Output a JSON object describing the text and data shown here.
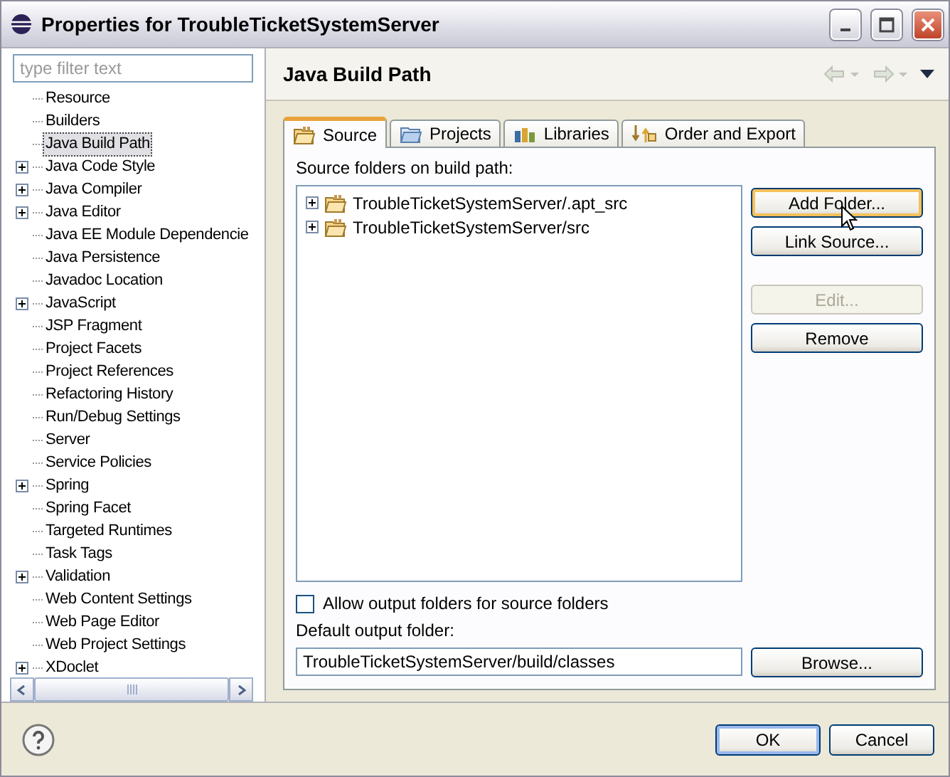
{
  "window": {
    "title": "Properties for TroubleTicketSystemServer"
  },
  "filter": {
    "placeholder": "type filter text"
  },
  "tree": {
    "items": [
      {
        "label": "Resource",
        "expandable": false,
        "selected": false
      },
      {
        "label": "Builders",
        "expandable": false,
        "selected": false
      },
      {
        "label": "Java Build Path",
        "expandable": false,
        "selected": true
      },
      {
        "label": "Java Code Style",
        "expandable": true,
        "selected": false
      },
      {
        "label": "Java Compiler",
        "expandable": true,
        "selected": false
      },
      {
        "label": "Java Editor",
        "expandable": true,
        "selected": false
      },
      {
        "label": "Java EE Module Dependencie",
        "expandable": false,
        "selected": false
      },
      {
        "label": "Java Persistence",
        "expandable": false,
        "selected": false
      },
      {
        "label": "Javadoc Location",
        "expandable": false,
        "selected": false
      },
      {
        "label": "JavaScript",
        "expandable": true,
        "selected": false
      },
      {
        "label": "JSP Fragment",
        "expandable": false,
        "selected": false
      },
      {
        "label": "Project Facets",
        "expandable": false,
        "selected": false
      },
      {
        "label": "Project References",
        "expandable": false,
        "selected": false
      },
      {
        "label": "Refactoring History",
        "expandable": false,
        "selected": false
      },
      {
        "label": "Run/Debug Settings",
        "expandable": false,
        "selected": false
      },
      {
        "label": "Server",
        "expandable": false,
        "selected": false
      },
      {
        "label": "Service Policies",
        "expandable": false,
        "selected": false
      },
      {
        "label": "Spring",
        "expandable": true,
        "selected": false
      },
      {
        "label": "Spring Facet",
        "expandable": false,
        "selected": false
      },
      {
        "label": "Targeted Runtimes",
        "expandable": false,
        "selected": false
      },
      {
        "label": "Task Tags",
        "expandable": false,
        "selected": false
      },
      {
        "label": "Validation",
        "expandable": true,
        "selected": false
      },
      {
        "label": "Web Content Settings",
        "expandable": false,
        "selected": false
      },
      {
        "label": "Web Page Editor",
        "expandable": false,
        "selected": false
      },
      {
        "label": "Web Project Settings",
        "expandable": false,
        "selected": false
      },
      {
        "label": "XDoclet",
        "expandable": true,
        "selected": false
      }
    ]
  },
  "page": {
    "title": "Java Build Path"
  },
  "tabs": [
    {
      "label": "Source",
      "kind": "source",
      "selected": true
    },
    {
      "label": "Projects",
      "kind": "projects",
      "selected": false
    },
    {
      "label": "Libraries",
      "kind": "libraries",
      "selected": false
    },
    {
      "label": "Order and Export",
      "kind": "order",
      "selected": false
    }
  ],
  "source": {
    "label": "Source folders on build path:",
    "folders": [
      {
        "label": "TroubleTicketSystemServer/.apt_src",
        "expandable": true
      },
      {
        "label": "TroubleTicketSystemServer/src",
        "expandable": true
      }
    ],
    "buttons": [
      {
        "label": "Add Folder...",
        "disabled": false,
        "focused": true
      },
      {
        "label": "Link Source...",
        "disabled": false,
        "focused": false
      },
      {
        "label": "Edit...",
        "disabled": true,
        "focused": false
      },
      {
        "label": "Remove",
        "disabled": false,
        "focused": false
      }
    ],
    "allow_output": {
      "label": "Allow output folders for source folders",
      "checked": false
    },
    "output_label": "Default output folder:",
    "output_value": "TroubleTicketSystemServer/build/classes",
    "browse": "Browse..."
  },
  "dialog_buttons": [
    {
      "label": "OK",
      "default": true
    },
    {
      "label": "Cancel",
      "default": false
    }
  ]
}
